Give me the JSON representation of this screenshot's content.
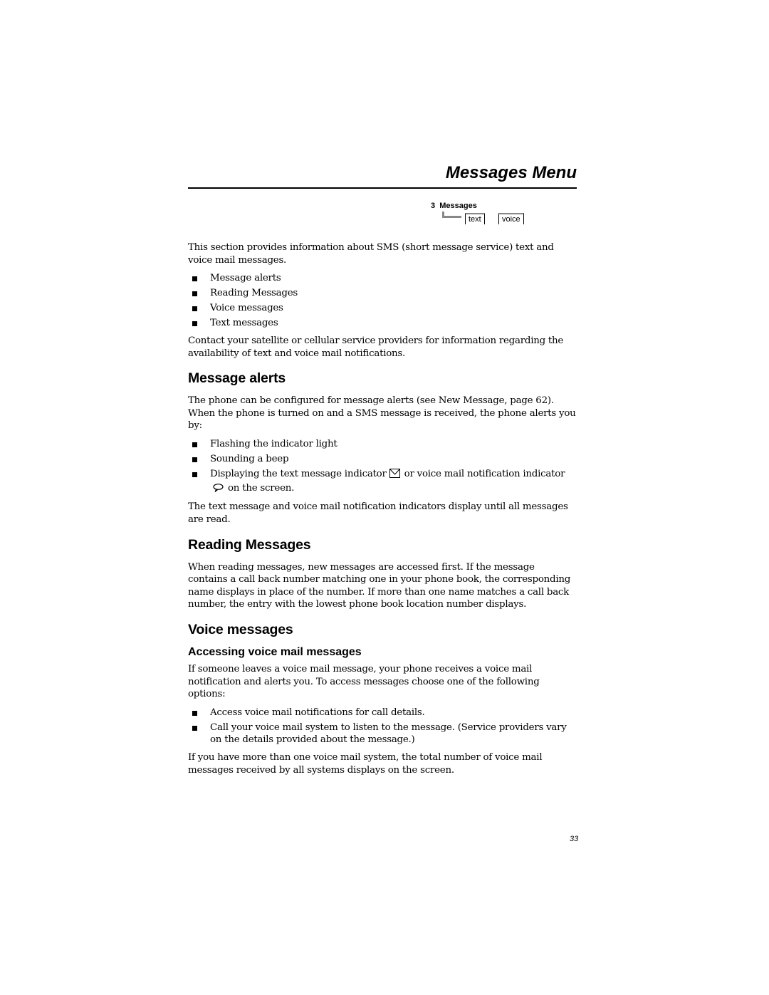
{
  "header": {
    "chapter_title": "Messages Menu"
  },
  "menu_map": {
    "number": "3",
    "label": "Messages",
    "softkeys": [
      "text",
      "voice"
    ]
  },
  "intro": {
    "paragraph": "This section provides information about SMS (short message service) text and voice mail messages.",
    "bullets": [
      "Message alerts",
      "Reading Messages",
      "Voice messages",
      "Text messages"
    ],
    "contact_note": "Contact your satellite or cellular service providers for information regarding the availability of text and voice mail notifications."
  },
  "message_alerts": {
    "heading": "Message alerts",
    "paragraph": "The phone can be configured for message alerts (see New Message, page 62). When the phone is turned on and a SMS message is received, the phone alerts you by:",
    "bullets": [
      "Flashing the indicator light",
      "Sounding a beep"
    ],
    "indicator_bullet": {
      "part1": "Displaying the text message indicator",
      "part2": "or voice mail notification indicator",
      "part3": "on the screen."
    },
    "after": "The text message and voice mail notification indicators display until all messages are read."
  },
  "reading_messages": {
    "heading": "Reading Messages",
    "paragraph": "When reading messages, new messages are accessed first. If the message contains a call back number matching one in your phone book, the corresponding name displays in place of the number. If more than one name matches a call back number, the entry with the lowest phone book location number displays."
  },
  "voice_messages": {
    "heading": "Voice messages",
    "subheading": "Accessing voice mail messages",
    "paragraph": "If someone leaves a voice mail message, your phone receives a voice mail notification and alerts you. To access messages choose one of the following options:",
    "bullets": [
      "Access voice mail notifications for call details.",
      "Call your voice mail system to listen to the message. (Service providers vary on the details provided about the message.)"
    ],
    "after": "If you have more than one voice mail system, the total number of voice mail messages received by all systems displays on the screen."
  },
  "footer": {
    "page_number": "33"
  }
}
